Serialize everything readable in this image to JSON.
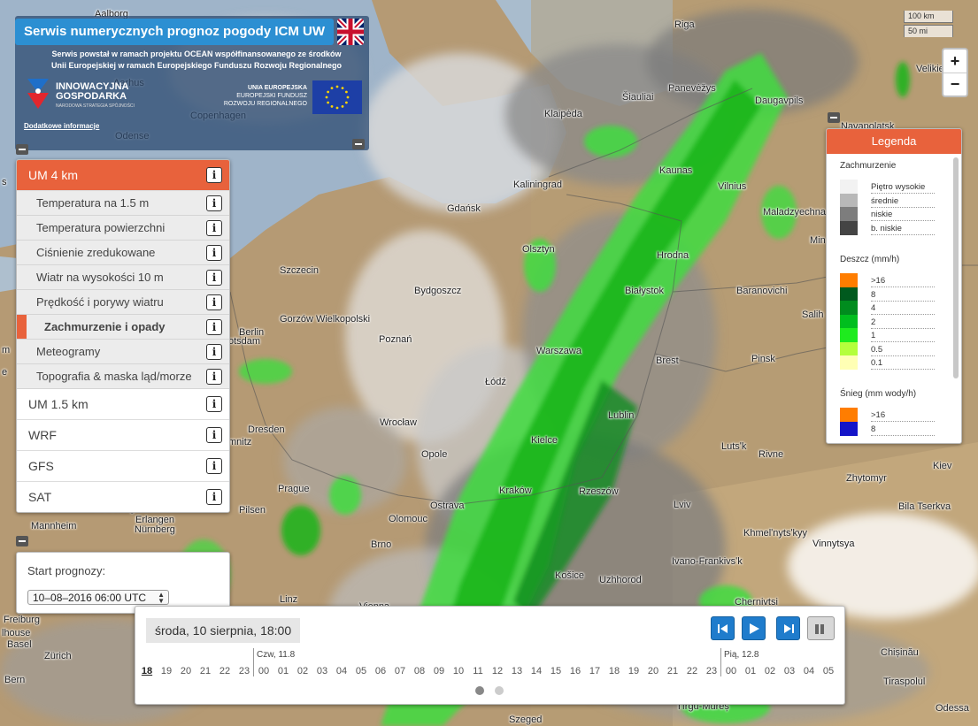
{
  "header": {
    "title": "Serwis numerycznych prognoz pogody ICM UW",
    "description_line1": "Serwis powstał w ramach projektu OCEAN współfinansowanego ze środków",
    "description_line2": "Unii Europejskiej w ramach Europejskiego Funduszu Rozwoju Regionalnego",
    "logo_name": "INNOWACYJNA GOSPODARKA",
    "logo_sub": "NARODOWA STRATEGIA SPÓJNOŚCI",
    "eu_line1": "UNIA EUROPEJSKA",
    "eu_line2": "EUROPEJSKI FUNDUSZ",
    "eu_line3": "ROZWOJU REGIONALNEGO",
    "more_info": "Dodatkowe informacje",
    "lang_icon": "uk-flag-icon"
  },
  "menu": {
    "active_model": "UM 4 km",
    "submenu": [
      "Temperatura na 1.5 m",
      "Temperatura powierzchni",
      "Ciśnienie zredukowane",
      "Wiatr na wysokości 10 m",
      "Prędkość i porywy wiatru",
      "Zachmurzenie i opady",
      "Meteogramy",
      "Topografia & maska ląd/morze"
    ],
    "selected_submenu": "Zachmurzenie i opady",
    "other_models": [
      "UM 1.5 km",
      "WRF",
      "GFS",
      "SAT"
    ],
    "info_glyph": "i"
  },
  "start": {
    "label": "Start prognozy:",
    "value": "10–08–2016 06:00 UTC"
  },
  "legend": {
    "title": "Legenda",
    "clouds": {
      "title": "Zachmurzenie",
      "items": [
        {
          "label": "Piętro wysokie",
          "color": "#f2f2f2"
        },
        {
          "label": "średnie",
          "color": "#b8b8b8"
        },
        {
          "label": "niskie",
          "color": "#7d7d7d"
        },
        {
          "label": "b. niskie",
          "color": "#444444"
        }
      ]
    },
    "rain": {
      "title": "Deszcz (mm/h)",
      "items": [
        {
          "label": ">16",
          "color": "#ff7d00"
        },
        {
          "label": "8",
          "color": "#005a1e"
        },
        {
          "label": "4",
          "color": "#008c1e"
        },
        {
          "label": "2",
          "color": "#00be1e"
        },
        {
          "label": "1",
          "color": "#1eeb1e"
        },
        {
          "label": "0.5",
          "color": "#b4ff3c"
        },
        {
          "label": "0.1",
          "color": "#ffffb4"
        }
      ]
    },
    "snow": {
      "title": "Śnieg (mm wody/h)",
      "items": [
        {
          "label": ">16",
          "color": "#ff7d00"
        },
        {
          "label": "8",
          "color": "#1414c8"
        }
      ]
    }
  },
  "zoom": {
    "in": "+",
    "out": "−"
  },
  "scale": {
    "km": "100 km",
    "mi": "50 mi"
  },
  "timeline": {
    "current": "środa, 10 sierpnia, 18:00",
    "day2_label": "Czw, 11.8",
    "day3_label": "Pią, 12.8",
    "hours_day1": [
      "18",
      "19",
      "20",
      "21",
      "22",
      "23"
    ],
    "hours_day2": [
      "00",
      "01",
      "02",
      "03",
      "04",
      "05",
      "06",
      "07",
      "08",
      "09",
      "10",
      "11",
      "12",
      "13",
      "14",
      "15",
      "16",
      "17",
      "18",
      "19",
      "20",
      "21",
      "22",
      "23"
    ],
    "hours_day3": [
      "00",
      "01",
      "02",
      "03",
      "04",
      "05"
    ],
    "current_hour": "18"
  },
  "map_labels": [
    {
      "name": "Riga"
    },
    {
      "name": "Velikie"
    },
    {
      "name": "Šiauliai"
    },
    {
      "name": "Panevėžys"
    },
    {
      "name": "Daugavpils"
    },
    {
      "name": "Klaipėda"
    },
    {
      "name": "Navapolatsk"
    },
    {
      "name": "Kaunas"
    },
    {
      "name": "Vilnius"
    },
    {
      "name": "Kaliningrad"
    },
    {
      "name": "Maladzyechna"
    },
    {
      "name": "Gdańsk"
    },
    {
      "name": "Olsztyn"
    },
    {
      "name": "Hrodna"
    },
    {
      "name": "Min"
    },
    {
      "name": "Szczecin"
    },
    {
      "name": "Bydgoszcz"
    },
    {
      "name": "Białystok"
    },
    {
      "name": "Baranovichi"
    },
    {
      "name": "Gorzów Wielkopolski"
    },
    {
      "name": "Salih"
    },
    {
      "name": "Berlin"
    },
    {
      "name": "otsdam"
    },
    {
      "name": "Poznań"
    },
    {
      "name": "Warszawa"
    },
    {
      "name": "Brest"
    },
    {
      "name": "Pinsk"
    },
    {
      "name": "Łódź"
    },
    {
      "name": "Lublin"
    },
    {
      "name": "Dresden"
    },
    {
      "name": "Wrocław"
    },
    {
      "name": "mnitz"
    },
    {
      "name": "Opole"
    },
    {
      "name": "Kielce"
    },
    {
      "name": "Lutsʹk"
    },
    {
      "name": "Rivne"
    },
    {
      "name": "Kiev"
    },
    {
      "name": "Zhytomyr"
    },
    {
      "name": "Prague"
    },
    {
      "name": "Kraków"
    },
    {
      "name": "Rzeszów"
    },
    {
      "name": "Darmstadt"
    },
    {
      "name": "Wurzburg"
    },
    {
      "name": "Pilsen"
    },
    {
      "name": "Ostrava"
    },
    {
      "name": "Olomouc"
    },
    {
      "name": "Lviv"
    },
    {
      "name": "Bila Tserkva"
    },
    {
      "name": "Erlangen"
    },
    {
      "name": "Nürnberg"
    },
    {
      "name": "Mannheim"
    },
    {
      "name": "Brno"
    },
    {
      "name": "Khmelʹnytsʹkyy"
    },
    {
      "name": "Vinnytsya"
    },
    {
      "name": "Ivano-Frankivsʹk"
    },
    {
      "name": "Košice"
    },
    {
      "name": "Uzhhorod"
    },
    {
      "name": "Linz"
    },
    {
      "name": "Vienna"
    },
    {
      "name": "Chernivtsi"
    },
    {
      "name": "Freiburg"
    },
    {
      "name": "lhouse"
    },
    {
      "name": "Basel"
    },
    {
      "name": "Zürich"
    },
    {
      "name": "Bern"
    },
    {
      "name": "Chișinău"
    },
    {
      "name": "Tiraspolul"
    },
    {
      "name": "Szeged"
    },
    {
      "name": "Tîrgu-Mureș"
    },
    {
      "name": "Odessa"
    },
    {
      "name": "Copenhagen"
    },
    {
      "name": "Odense"
    },
    {
      "name": "Aarhus"
    },
    {
      "name": "Aalborg"
    },
    {
      "name": "s"
    },
    {
      "name": "m"
    },
    {
      "name": "e"
    }
  ]
}
